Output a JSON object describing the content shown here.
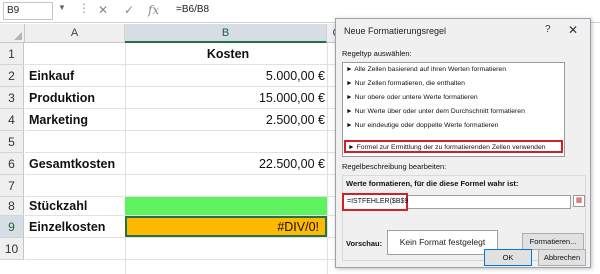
{
  "formula_bar": {
    "name_box": "B9",
    "dots": "⋮",
    "cancel_glyph": "✕",
    "enter_glyph": "✓",
    "fx_glyph": "fx",
    "formula": "=B6/B8"
  },
  "columns": [
    "A",
    "B",
    "C"
  ],
  "rows": [
    {
      "num": "1",
      "a": "",
      "b": "Kosten"
    },
    {
      "num": "2",
      "a": "Einkauf",
      "b": "5.000,00 €"
    },
    {
      "num": "3",
      "a": "Produktion",
      "b": "15.000,00 €"
    },
    {
      "num": "4",
      "a": "Marketing",
      "b": "2.500,00 €"
    },
    {
      "num": "5",
      "a": "",
      "b": ""
    },
    {
      "num": "6",
      "a": "Gesamtkosten",
      "b": "22.500,00 €"
    },
    {
      "num": "7",
      "a": "",
      "b": ""
    },
    {
      "num": "8",
      "a": "Stückzahl",
      "b": ""
    },
    {
      "num": "9",
      "a": "Einzelkosten",
      "b": "#DIV/0!"
    },
    {
      "num": "10",
      "a": "",
      "b": ""
    }
  ],
  "colors": {
    "accent": "#217346",
    "green_fill": "#5ef25e",
    "orange_fill": "#ffb900",
    "highlight_red": "#d32026"
  },
  "dialog": {
    "title": "Neue Formatierungsregel",
    "help_glyph": "?",
    "close_glyph": "✕",
    "rule_type_label": "Regeltyp auswählen:",
    "rule_types": [
      "► Alle Zellen basierend auf ihren Werten formatieren",
      "► Nur Zellen formatieren, die enthalten",
      "► Nur obere oder untere Werte formatieren",
      "► Nur Werte über oder unter dem Durchschnitt formatieren",
      "► Nur eindeutige oder doppelte Werte formatieren",
      "► Formel zur Ermittlung der zu formatierenden Zellen verwenden"
    ],
    "selected_rule_index": 5,
    "rule_desc_label": "Regelbeschreibung bearbeiten:",
    "formula_label": "Werte formatieren, für die diese Formel wahr ist:",
    "formula_value": "=ISTFEHLER($B$9)",
    "preview_label": "Vorschau:",
    "preview_text": "Kein Format festgelegt",
    "format_button": "Formatieren...",
    "ok_button": "OK",
    "cancel_button": "Abbrechen"
  }
}
